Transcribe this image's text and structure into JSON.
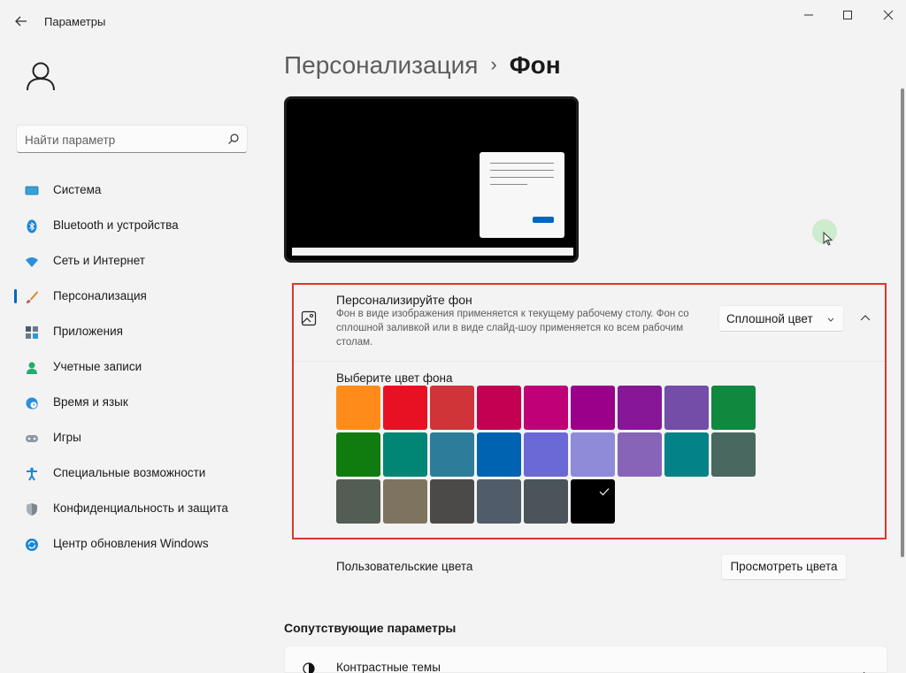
{
  "window": {
    "title": "Параметры",
    "back_icon": "arrow-left-icon",
    "minimize_icon": "minimize-icon",
    "maximize_icon": "maximize-icon",
    "close_icon": "close-icon"
  },
  "sidebar": {
    "search_placeholder": "Найти параметр",
    "items": [
      {
        "label": "Система",
        "icon": "monitor-icon"
      },
      {
        "label": "Bluetooth и устройства",
        "icon": "bluetooth-icon"
      },
      {
        "label": "Сеть и Интернет",
        "icon": "wifi-icon"
      },
      {
        "label": "Персонализация",
        "icon": "brush-icon"
      },
      {
        "label": "Приложения",
        "icon": "apps-icon"
      },
      {
        "label": "Учетные записи",
        "icon": "account-icon"
      },
      {
        "label": "Время и язык",
        "icon": "globe-clock-icon"
      },
      {
        "label": "Игры",
        "icon": "gamepad-icon"
      },
      {
        "label": "Специальные возможности",
        "icon": "accessibility-icon"
      },
      {
        "label": "Конфиденциальность и защита",
        "icon": "shield-icon"
      },
      {
        "label": "Центр обновления Windows",
        "icon": "update-icon"
      }
    ],
    "active_index": 3
  },
  "breadcrumb": {
    "parent": "Персонализация",
    "separator": "›",
    "current": "Фон"
  },
  "background_card": {
    "title": "Персонализируйте фон",
    "description": "Фон в виде изображения применяется к текущему рабочему столу. Фон со сплошной заливкой или в виде слайд-шоу применяется ко всем рабочим столам.",
    "dropdown_value": "Сплошной цвет",
    "swatch_label": "Выберите цвет фона",
    "swatches": [
      "#ff8c1a",
      "#e81123",
      "#d13438",
      "#c30052",
      "#bf0077",
      "#9a0089",
      "#881798",
      "#744da9",
      "#10893e",
      "#107c10",
      "#018574",
      "#2d7d9a",
      "#0063b1",
      "#6b69d6",
      "#8e8cd8",
      "#8764b8",
      "#038387",
      "#486860",
      "#525e54",
      "#7e735f",
      "#4c4a48",
      "#515c6b",
      "#4a5459",
      "#000000"
    ],
    "selected_swatch": 23
  },
  "custom_colors": {
    "label": "Пользовательские цвета",
    "button": "Просмотреть цвета"
  },
  "related": {
    "title": "Сопутствующие параметры",
    "contrast_label": "Контрастные темы"
  },
  "colors": {
    "accent": "#0067c0",
    "highlight_border": "#d9372b"
  }
}
